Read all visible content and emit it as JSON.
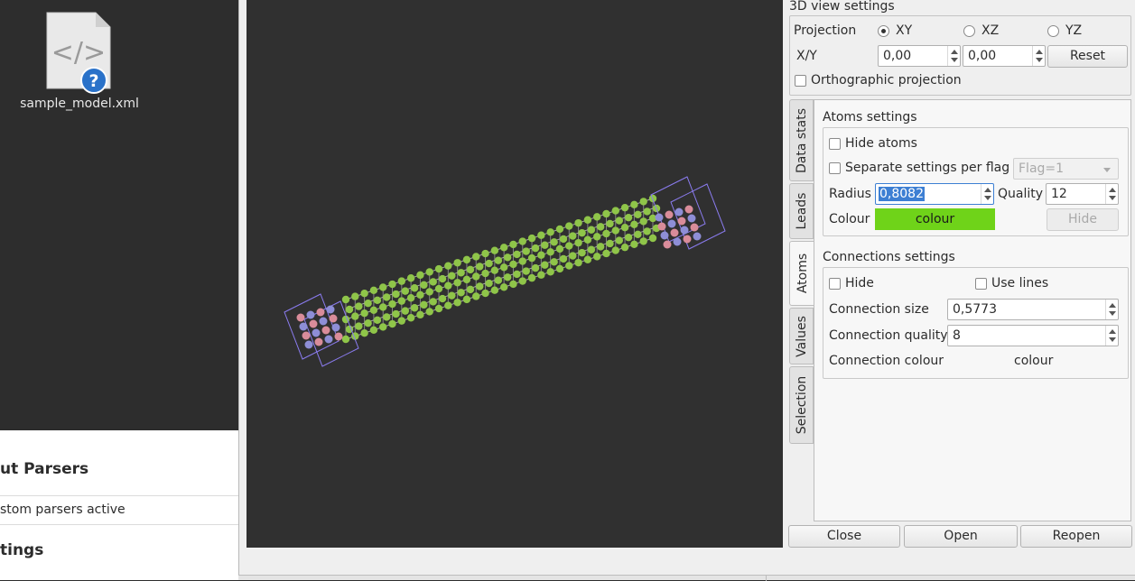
{
  "desktop": {
    "file_name": "sample_model.xml",
    "file_icon": "xml-file-unknown-icon"
  },
  "background_app": {
    "heading1": "ut Parsers",
    "row1": "stom parsers active",
    "heading2": "tings"
  },
  "view_settings": {
    "title": "3D view settings",
    "projection_label": "Projection",
    "projections": [
      "XY",
      "XZ",
      "YZ"
    ],
    "selected_projection": "XY",
    "xy_label": "X/Y",
    "x_value": "0,00",
    "y_value": "0,00",
    "reset_label": "Reset",
    "ortho_label": "Orthographic projection",
    "ortho_checked": false
  },
  "tabs": [
    "Data stats",
    "Leads",
    "Atoms",
    "Values",
    "Selection"
  ],
  "active_tab": "Atoms",
  "atoms": {
    "title": "Atoms settings",
    "hide_label": "Hide atoms",
    "separate_label": "Separate settings per flag",
    "flag_value": "Flag=1",
    "radius_label": "Radius",
    "radius_value": "0,8082",
    "quality_label": "Quality",
    "quality_value": "12",
    "colour_label": "Colour",
    "colour_button": "colour",
    "colour_hex": "#6fd319",
    "hide_button": "Hide"
  },
  "connections": {
    "title": "Connections settings",
    "hide_label": "Hide",
    "use_lines_label": "Use lines",
    "size_label": "Connection size",
    "size_value": "0,5773",
    "quality_label": "Connection quality",
    "quality_value": "8",
    "colour_label": "Connection colour",
    "colour_button": "colour"
  },
  "buttons": {
    "close": "Close",
    "open": "Open",
    "reopen": "Reopen"
  },
  "model_colors": {
    "atom": "#8fc549",
    "lead_a": "#d98c9a",
    "lead_b": "#8e8ed6",
    "box": "#8b7cf0",
    "bond": "#d8d8d8"
  }
}
